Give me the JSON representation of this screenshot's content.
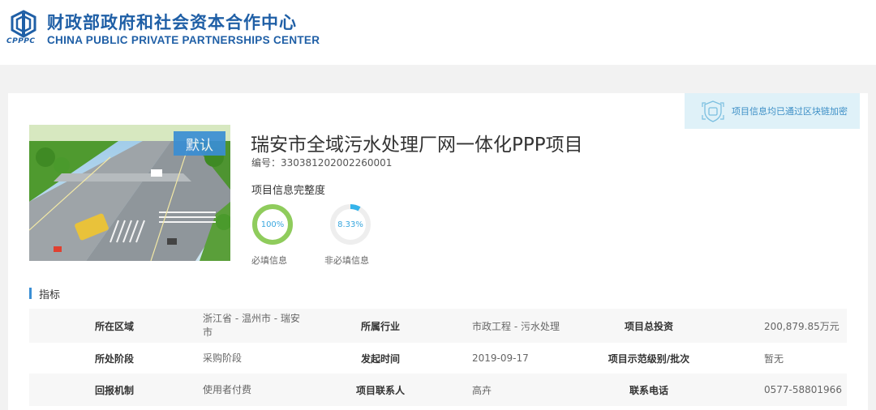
{
  "header": {
    "logo_abbr": "CPPPC",
    "org_name_cn": "财政部政府和社会资本合作中心",
    "org_name_en": "CHINA PUBLIC PRIVATE PARTNERSHIPS CENTER"
  },
  "banner": {
    "icon": "blockchain-shield-icon",
    "text": "项目信息均已通过区块链加密"
  },
  "project": {
    "image_badge": "默认",
    "title": "瑞安市全域污水处理厂网一体化PPP项目",
    "code": "编号：330381202002260001",
    "completeness_label": "项目信息完整度",
    "required": {
      "value": "100%",
      "fraction": 1.0,
      "caption": "必填信息",
      "color": "#8fcc5c"
    },
    "optional": {
      "value": "8.33%",
      "fraction": 0.0833,
      "caption": "非必填信息",
      "color": "#35b3ea"
    }
  },
  "indicators": {
    "title": "指标",
    "rows": [
      [
        {
          "label": "所在区域",
          "value": "浙江省 - 温州市 - 瑞安市"
        },
        {
          "label": "所属行业",
          "value": "市政工程 - 污水处理"
        },
        {
          "label": "项目总投资",
          "value": "200,879.85万元"
        }
      ],
      [
        {
          "label": "所处阶段",
          "value": "采购阶段"
        },
        {
          "label": "发起时间",
          "value": "2019-09-17"
        },
        {
          "label": "项目示范级别/批次",
          "value": "暂无"
        }
      ],
      [
        {
          "label": "回报机制",
          "value": "使用者付费"
        },
        {
          "label": "项目联系人",
          "value": "高卉"
        },
        {
          "label": "联系电话",
          "value": "0577-58801966"
        }
      ]
    ]
  },
  "colors": {
    "brand": "#1f5fa6",
    "accent": "#3a8ed4",
    "banner_bg": "#dff1f8"
  }
}
